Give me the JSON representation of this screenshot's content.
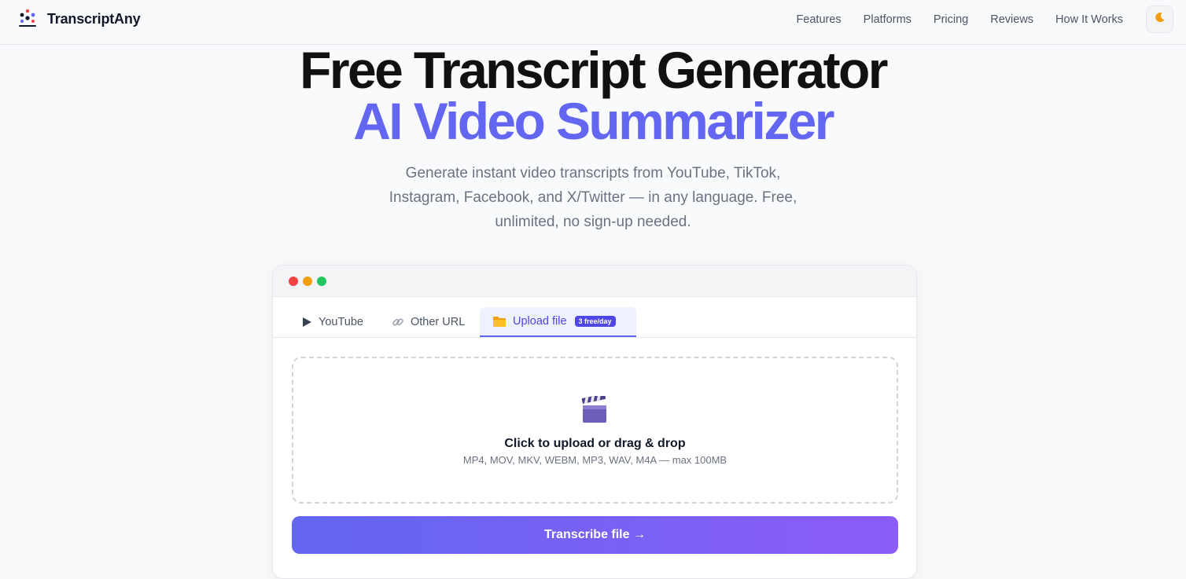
{
  "brand": {
    "name": "TranscriptAny",
    "logo_icon": "logo-icon"
  },
  "nav": {
    "items": [
      "Features",
      "Platforms",
      "Pricing",
      "Reviews",
      "How It Works"
    ],
    "theme_icon": "moon-icon"
  },
  "hero": {
    "title_line1": "Free Transcript Generator",
    "title_line2": "AI Video Summarizer",
    "subtitle": "Generate instant video transcripts from YouTube, TikTok, Instagram, Facebook, and X/Twitter — in any language. Free, unlimited, no sign-up needed."
  },
  "tabs": [
    {
      "label": "YouTube",
      "icon": "play-icon"
    },
    {
      "label": "Other URL",
      "icon": "link-icon"
    },
    {
      "label": "Upload file",
      "icon": "folder-icon",
      "badge": "3 free/day",
      "active": true
    }
  ],
  "upload": {
    "icon": "clapperboard-icon",
    "title": "Click to upload or drag & drop",
    "formats": "MP4, MOV, MKV, WEBM, MP3, WAV, M4A — max 100MB"
  },
  "cta": {
    "label": "Transcribe file →"
  },
  "colors": {
    "accent": "#6366f1",
    "accent_end": "#8b5cf6",
    "badge": "#4f46e5"
  }
}
